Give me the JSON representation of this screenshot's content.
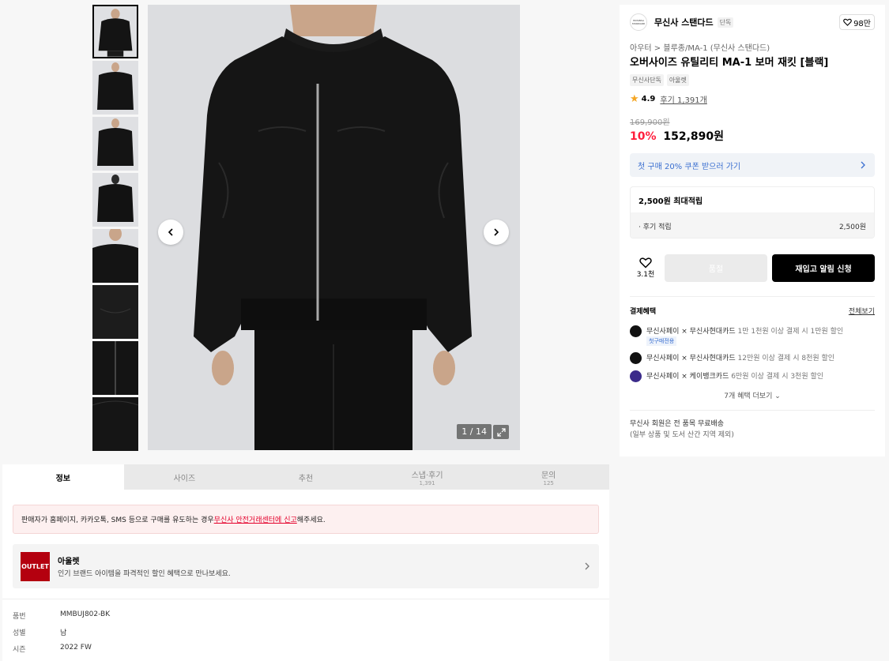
{
  "gallery": {
    "thumbnail_count": 8,
    "counter": "1 / 14"
  },
  "brand": {
    "logo_text": "MUSINSA STANDARD",
    "name": "무신사 스탠다드",
    "tag": "단독",
    "likes": "98만"
  },
  "product": {
    "breadcrumb_1": "아우터",
    "breadcrumb_sep": ">",
    "breadcrumb_2": "블루종/MA-1 (무신사 스탠다드)",
    "title": "오버사이즈 유틸리티 MA-1 보머 재킷 [블랙]",
    "tags": [
      "무신사단독",
      "아울렛"
    ],
    "rating": "4.9",
    "review_link": "후기 1,391개",
    "original_price": "169,900원",
    "discount": "10%",
    "price": "152,890원"
  },
  "coupon": {
    "label": "첫 구매 20% 쿠폰 받으러 가기"
  },
  "points": {
    "max_label": "2,500원 최대적립",
    "review_label": "· 후기 적립",
    "review_value": "2,500원"
  },
  "actions": {
    "wish_count": "3.1천",
    "soldout_label": "품절",
    "restock_label": "재입고 알림 신청"
  },
  "payment": {
    "heading": "결제혜택",
    "view_all": "전체보기",
    "items": [
      {
        "title": "무신사페이 × 무신사현대카드",
        "desc": " 1만 1천원 이상 결제 시 1만원 할인"
      },
      {
        "title": "무신사페이 × 무신사현대카드",
        "desc": " 12만원 이상 결제 시 8천원 할인"
      },
      {
        "title": "무신사페이 × 케이뱅크카드",
        "desc": " 6만원 이상 결제 시 3천원 할인"
      }
    ],
    "badge": "첫구매전용",
    "more_label": "7개 혜택 더보기 ⌄"
  },
  "shipping": {
    "line1": "무신사 회원은 전 품목 무료배송",
    "line2": "(일부 상품 및 도서 산간 지역 제외)"
  },
  "tabs": [
    {
      "label": "정보",
      "count": ""
    },
    {
      "label": "사이즈",
      "count": ""
    },
    {
      "label": "추천",
      "count": ""
    },
    {
      "label": "스냅·후기",
      "count": "1,391"
    },
    {
      "label": "문의",
      "count": "125"
    }
  ],
  "warning": {
    "text_before": "판매자가 홈페이지, 카카오톡, SMS 등으로 구매를 유도하는 경우 ",
    "link": "무신사 안전거래센터에 신고",
    "text_after": " 해주세요."
  },
  "outlet": {
    "logo": "OUTLET",
    "title": "아울렛",
    "desc": "인기 브랜드 아이템을 파격적인 할인 혜택으로 만나보세요."
  },
  "info": [
    {
      "key": "품번",
      "value": "MMBUJ802-BK"
    },
    {
      "key": "성별",
      "value": "남"
    },
    {
      "key": "시즌",
      "value": "2022 FW"
    }
  ]
}
